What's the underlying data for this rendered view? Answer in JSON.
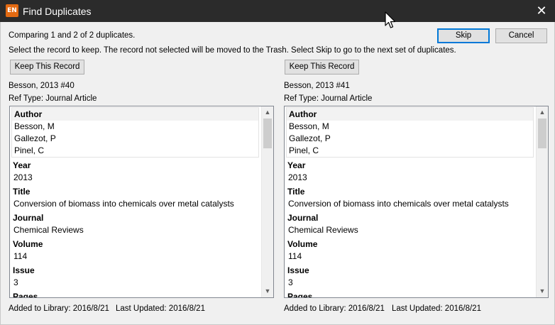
{
  "window": {
    "icon_text": "EN",
    "title": "Find Duplicates"
  },
  "info": {
    "comparing": "Comparing 1 and 2 of 2 duplicates.",
    "instructions": "Select the record to keep. The record not selected will be moved to the Trash. Select Skip to go to the next set of duplicates."
  },
  "buttons": {
    "skip": "Skip",
    "cancel": "Cancel",
    "keep": "Keep This Record"
  },
  "records": [
    {
      "id": "Besson, 2013 #40",
      "ref_type": "Ref Type: Journal Article",
      "authors": [
        "Besson, M",
        "Gallezot, P",
        "Pinel, C"
      ],
      "year": "2013",
      "title": "Conversion of biomass into chemicals over metal catalysts",
      "journal": "Chemical Reviews",
      "volume": "114",
      "issue": "3",
      "added": "Added to Library: 2016/8/21",
      "updated": "Last Updated: 2016/8/21"
    },
    {
      "id": "Besson, 2013 #41",
      "ref_type": "Ref Type: Journal Article",
      "authors": [
        "Besson, M",
        "Gallezot, P",
        "Pinel, C"
      ],
      "year": "2013",
      "title": "Conversion of biomass into chemicals over metal catalysts",
      "journal": "Chemical Reviews",
      "volume": "114",
      "issue": "3",
      "added": "Added to Library: 2016/8/21",
      "updated": "Last Updated: 2016/8/21"
    }
  ],
  "labels": {
    "author": "Author",
    "year": "Year",
    "title": "Title",
    "journal": "Journal",
    "volume": "Volume",
    "issue": "Issue",
    "pages": "Pages"
  },
  "icons": {
    "close": "close-icon",
    "scroll_up": "chevron-up-icon",
    "scroll_down": "chevron-down-icon",
    "cursor": "mouse-cursor-icon"
  },
  "colors": {
    "titlebar": "#2b2b2b",
    "app_icon": "#e36a12",
    "default_button_border": "#0078d7"
  }
}
